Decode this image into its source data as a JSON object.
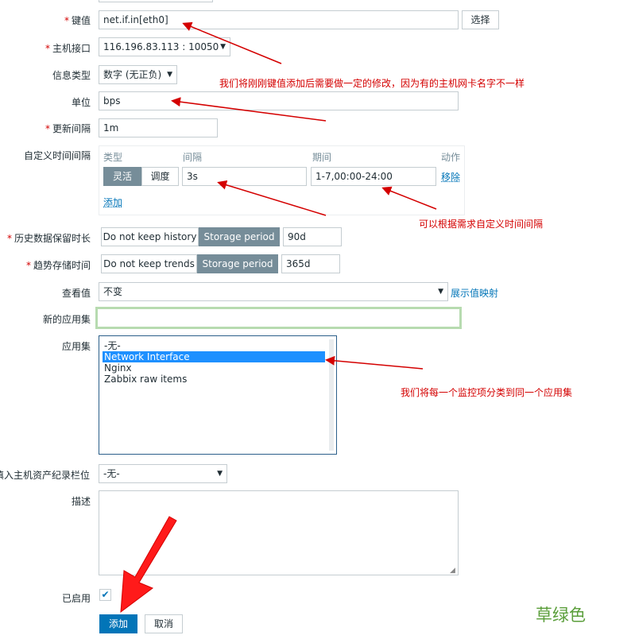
{
  "form": {
    "key": {
      "label": "键值",
      "value": "net.if.in[eth0]",
      "select_button": "选择"
    },
    "interface": {
      "label": "主机接口",
      "value": "116.196.83.113 : 10050"
    },
    "info_type": {
      "label": "信息类型",
      "value": "数字 (无正负)"
    },
    "units": {
      "label": "单位",
      "value": "bps"
    },
    "update_interval": {
      "label": "更新间隔",
      "value": "1m"
    },
    "custom_intervals": {
      "label": "自定义时间间隔",
      "headers": {
        "type": "类型",
        "interval": "间隔",
        "period": "期间",
        "action": "动作"
      },
      "type_flexible": "灵活",
      "type_scheduling": "调度",
      "interval_value": "3s",
      "period_value": "1-7,00:00-24:00",
      "remove": "移除",
      "add": "添加"
    },
    "history": {
      "label": "历史数据保留时长",
      "no_keep": "Do not keep history",
      "storage": "Storage period",
      "value": "90d"
    },
    "trends": {
      "label": "趋势存储时间",
      "no_keep": "Do not keep trends",
      "storage": "Storage period",
      "value": "365d"
    },
    "show_value": {
      "label": "查看值",
      "value": "不变",
      "mapping_link": "展示值映射"
    },
    "new_application": {
      "label": "新的应用集",
      "value": ""
    },
    "applications": {
      "label": "应用集",
      "options": [
        "-无-",
        "Network Interface",
        "Nginx",
        "Zabbix raw items"
      ],
      "selected_index": 1
    },
    "inventory": {
      "label": "填入主机资产纪录栏位",
      "value": "-无-"
    },
    "description": {
      "label": "描述",
      "value": ""
    },
    "enabled": {
      "label": "已启用",
      "checked": true
    },
    "buttons": {
      "add": "添加",
      "cancel": "取消"
    }
  },
  "annotations": {
    "note_key": "我们将刚刚键值添加后需要做一定的修改，因为有的主机网卡名字不一样",
    "note_interval": "可以根据需求自定义时间间隔",
    "note_app": "我们将每一个监控项分类到同一个应用集",
    "color_word": "草绿色"
  },
  "colors": {
    "accent": "#0275b8",
    "segment_active": "#768d99",
    "required": "#d40000",
    "annotation": "#d40000",
    "highlight_border": "#b7dbb0",
    "color_word": "#5a9e3a"
  }
}
